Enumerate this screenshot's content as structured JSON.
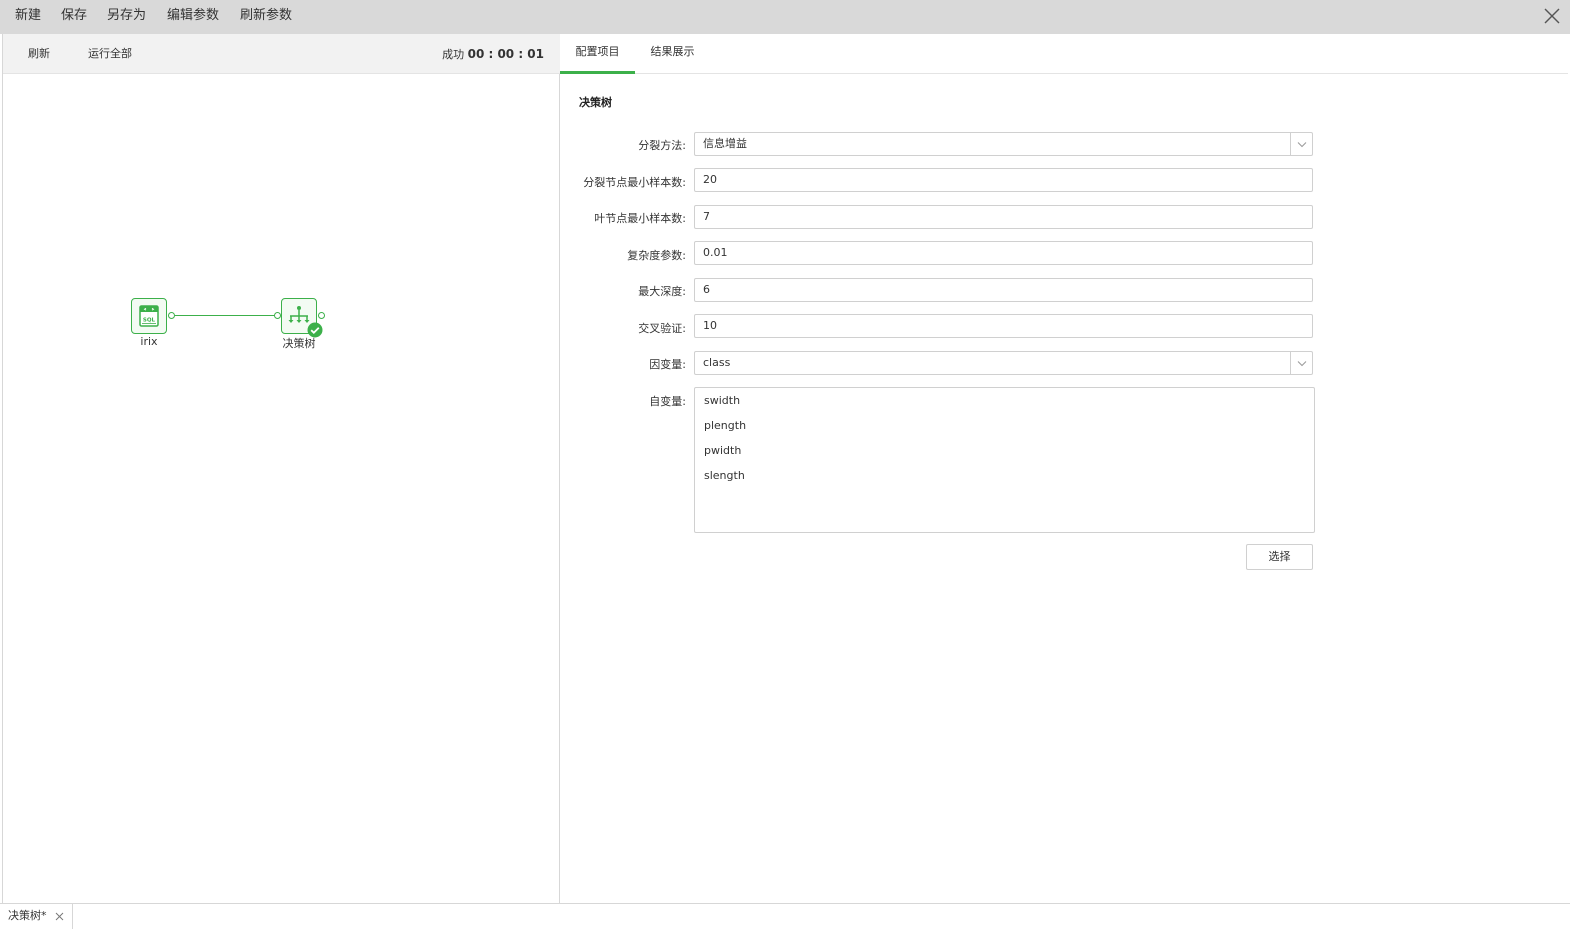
{
  "menubar": {
    "items": [
      "新建",
      "保存",
      "另存为",
      "编辑参数",
      "刷新参数"
    ]
  },
  "left_toolbar": {
    "refresh_label": "刷新",
    "run_all_label": "运行全部",
    "status_text": "成功",
    "timer": "00 : 00 : 01"
  },
  "canvas": {
    "nodes": [
      {
        "label": "irix",
        "icon": "sql-database-icon"
      },
      {
        "label": "决策树",
        "icon": "decision-tree-icon",
        "status": "success"
      }
    ]
  },
  "tabs": {
    "config_label": "配置项目",
    "results_label": "结果展示",
    "active": "配置项目"
  },
  "form": {
    "title": "决策树",
    "split_method": {
      "label": "分裂方法:",
      "value": "信息增益"
    },
    "min_split_samples": {
      "label": "分裂节点最小样本数:",
      "value": "20"
    },
    "min_leaf_samples": {
      "label": "叶节点最小样本数:",
      "value": "7"
    },
    "complexity": {
      "label": "复杂度参数:",
      "value": "0.01"
    },
    "max_depth": {
      "label": "最大深度:",
      "value": "6"
    },
    "cross_validation": {
      "label": "交叉验证:",
      "value": "10"
    },
    "dependent_var": {
      "label": "因变量:",
      "value": "class"
    },
    "independent_vars": {
      "label": "自变量:",
      "items": [
        "swidth",
        "plength",
        "pwidth",
        "slength"
      ]
    },
    "select_button": "选择"
  },
  "bottom_tab": {
    "label": "决策树*"
  },
  "colors": {
    "accent": "#3cb04a",
    "topbar_bg": "#d9d9d9",
    "toolbar_bg": "#f2f2f2"
  }
}
